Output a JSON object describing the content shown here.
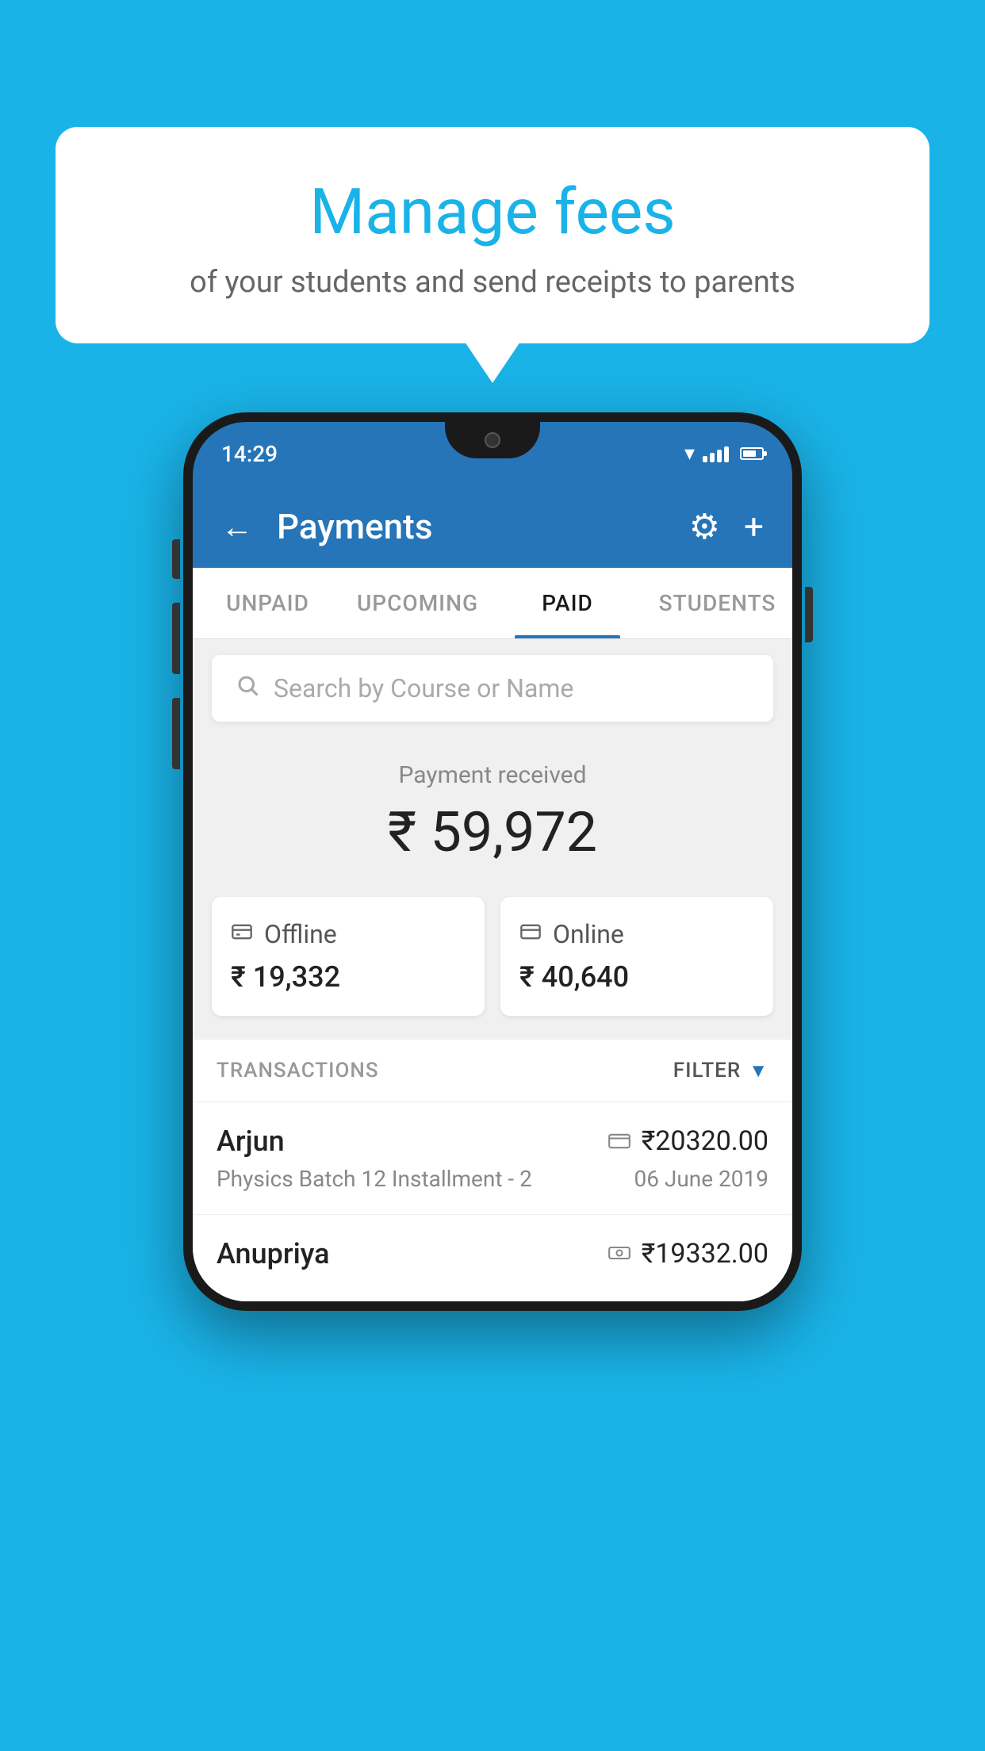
{
  "bubble": {
    "title": "Manage fees",
    "subtitle": "of your students and send receipts to parents"
  },
  "status_bar": {
    "time": "14:29"
  },
  "header": {
    "title": "Payments",
    "back_label": "←",
    "settings_label": "⚙",
    "add_label": "+"
  },
  "tabs": [
    {
      "label": "UNPAID",
      "active": false
    },
    {
      "label": "UPCOMING",
      "active": false
    },
    {
      "label": "PAID",
      "active": true
    },
    {
      "label": "STUDENTS",
      "active": false
    }
  ],
  "search": {
    "placeholder": "Search by Course or Name"
  },
  "payment_received": {
    "label": "Payment received",
    "amount": "₹ 59,972"
  },
  "payment_cards": [
    {
      "icon": "offline",
      "label": "Offline",
      "amount": "₹ 19,332"
    },
    {
      "icon": "online",
      "label": "Online",
      "amount": "₹ 40,640"
    }
  ],
  "transactions": {
    "label": "TRANSACTIONS",
    "filter_label": "FILTER"
  },
  "transaction_list": [
    {
      "name": "Arjun",
      "icon": "card",
      "amount": "₹20320.00",
      "description": "Physics Batch 12 Installment - 2",
      "date": "06 June 2019"
    },
    {
      "name": "Anupriya",
      "icon": "cash",
      "amount": "₹19332.00",
      "description": "",
      "date": ""
    }
  ]
}
